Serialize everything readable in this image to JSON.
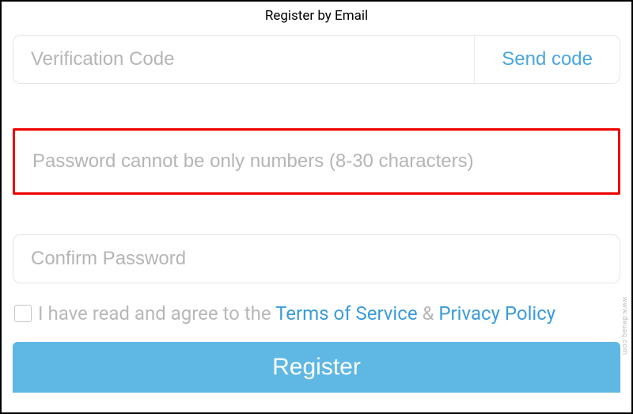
{
  "header": {
    "title": "Register by Email"
  },
  "fields": {
    "verification": {
      "placeholder": "Verification Code",
      "send_label": "Send code"
    },
    "password": {
      "placeholder": "Password cannot be only numbers (8-30 characters)"
    },
    "confirm": {
      "placeholder": "Confirm Password"
    }
  },
  "agree": {
    "prefix": "I have read and agree to the ",
    "terms": "Terms of Service",
    "and": " & ",
    "privacy": "Privacy Policy"
  },
  "actions": {
    "register": "Register"
  },
  "watermark": "www.deuaq.com"
}
